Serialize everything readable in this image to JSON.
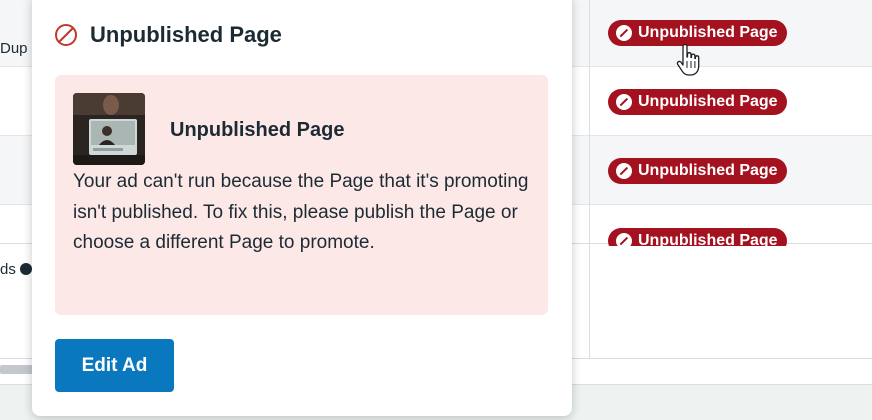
{
  "table": {
    "left_text_row1": "Dup",
    "left_text_row4": "ds",
    "status_badges": [
      "Unpublished Page",
      "Unpublished Page",
      "Unpublished Page",
      "Unpublished Page"
    ]
  },
  "popover": {
    "header_icon": "ban-icon",
    "title": "Unpublished Page",
    "error_panel": {
      "thumbnail": "page-thumbnail",
      "title": "Unpublished Page",
      "description": "Your ad can't run because the Page that it's promoting isn't published. To fix this, please publish the Page or choose a different Page to promote."
    },
    "edit_button_label": "Edit Ad"
  },
  "colors": {
    "badge_bg": "#a4111f",
    "panel_bg": "#fde8e8",
    "button_bg": "#0a78be",
    "header_icon": "#c0392b"
  }
}
